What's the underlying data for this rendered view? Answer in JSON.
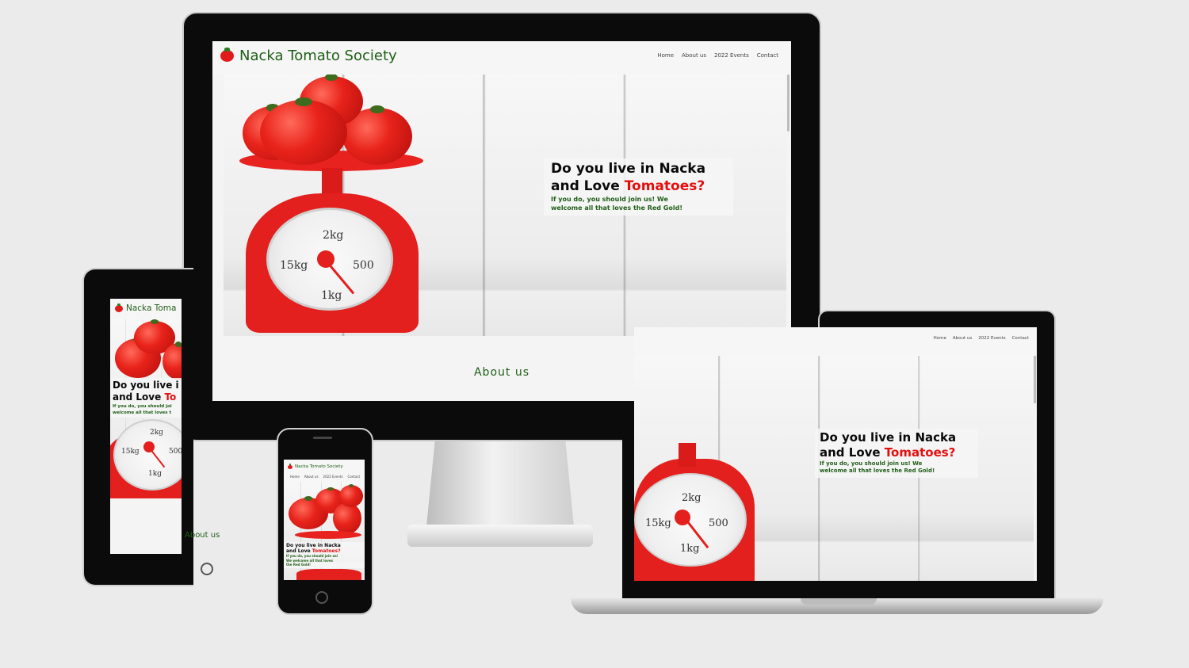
{
  "site": {
    "brand": "Nacka Tomato Society",
    "nav": [
      "Home",
      "About us",
      "2022 Events",
      "Contact"
    ],
    "hero": {
      "heading_line1": "Do you live in Nacka",
      "heading_line2_start": "and Love ",
      "heading_highlight": "Tomatoes?",
      "subtext_line1": "If you do, you should join us! We",
      "subtext_line2": "welcome all that loves the Red Gold!"
    },
    "about_heading": "About us",
    "scale_labels": {
      "top": "2kg",
      "left": "15kg",
      "right": "500",
      "bottom": "1kg"
    }
  },
  "tablet": {
    "brand": "Nacka Toma",
    "heading_line1": "Do you live i",
    "heading_line2_start": "and Love ",
    "heading_highlight": "To",
    "subtext_line1": "If you do, you should joi",
    "subtext_line2": "welcome all that loves t"
  },
  "phone": {
    "heading_line1": "Do you live in Nacka",
    "heading_line2_start": "and Love ",
    "heading_highlight": "Tomatoes?",
    "subtext_line1": "If you do, you should join us!",
    "subtext_line2": "We welcome all that loves",
    "subtext_line3": "the Red Gold!"
  },
  "colors": {
    "brand_green": "#1f5e17",
    "tomato_red": "#e30f0f",
    "background": "#ebebeb"
  }
}
